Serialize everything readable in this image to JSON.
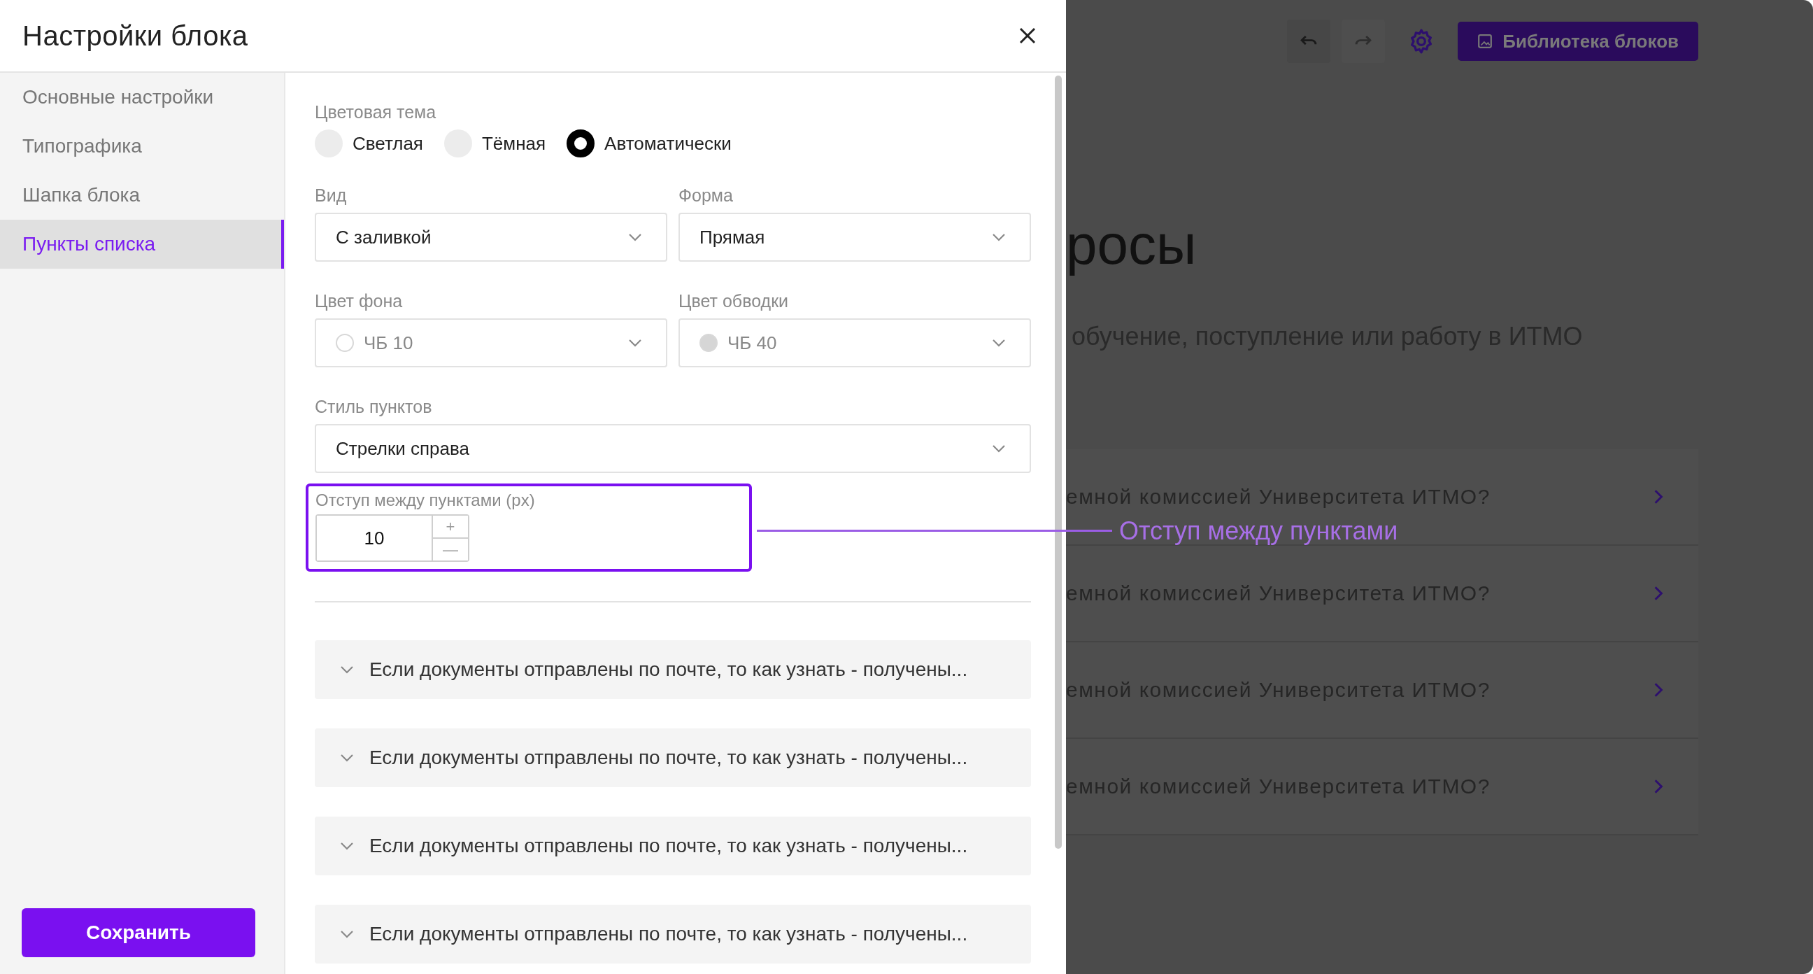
{
  "modal": {
    "title": "Настройки блока"
  },
  "sidebar": {
    "items": [
      {
        "label": "Основные настройки",
        "selected": false
      },
      {
        "label": "Типографика",
        "selected": false
      },
      {
        "label": "Шапка блока",
        "selected": false
      },
      {
        "label": "Пункты списка",
        "selected": true
      }
    ]
  },
  "theme": {
    "label": "Цветовая тема",
    "options": [
      {
        "label": "Светлая",
        "selected": false
      },
      {
        "label": "Тёмная",
        "selected": false
      },
      {
        "label": "Автоматически",
        "selected": true
      }
    ]
  },
  "field_rows": [
    [
      {
        "kind": "select",
        "label": "Вид",
        "value": "С заливкой"
      },
      {
        "kind": "select",
        "label": "Форма",
        "value": "Прямая"
      }
    ],
    [
      {
        "kind": "color_select",
        "label": "Цвет фона",
        "value": "ЧБ 10",
        "color": "#ffffff"
      },
      {
        "kind": "color_select",
        "label": "Цвет обводки",
        "value": "ЧБ 40",
        "color": "#d6d6d6"
      }
    ],
    [
      {
        "kind": "select",
        "label": "Стиль пунктов",
        "value": "Стрелки справа"
      }
    ]
  ],
  "spacing": {
    "label": "Отступ между пунктами (px)",
    "value": "10",
    "plus": "+",
    "minus": "—"
  },
  "items": [
    "Если документы отправлены по почте, то как узнать - получены...",
    "Если документы отправлены по почте, то как узнать - получены...",
    "Если документы отправлены по почте, то как узнать - получены...",
    "Если документы отправлены по почте, то как узнать - получены..."
  ],
  "save": "Сохранить",
  "callout": "Отступ между пунктами",
  "page": {
    "library_button": "Библиотека блоков",
    "heading": "росы",
    "subtitle": "обучение, поступление или работу в ИТМО",
    "questions": [
      "емной комиссией Университета ИТМО?",
      "емной комиссией Университета ИТМО?",
      "емной комиссией Университета ИТМО?",
      "емной комиссией Университета ИТМО?"
    ]
  }
}
